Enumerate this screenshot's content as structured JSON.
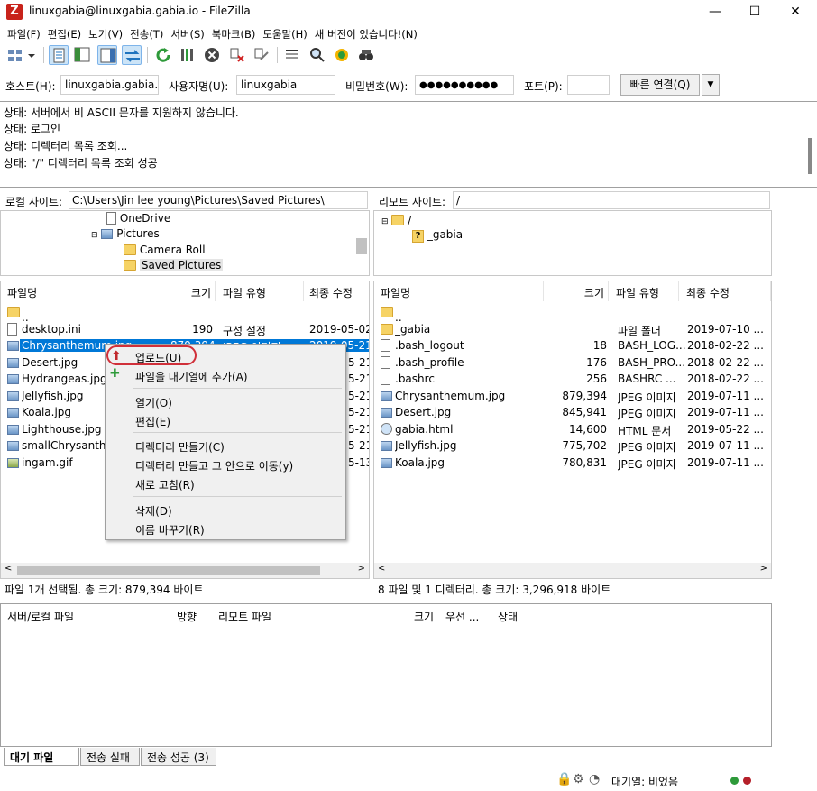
{
  "window": {
    "title": "linuxgabia@linuxgabia.gabia.io - FileZilla",
    "app_icon_letter": "Z",
    "minimize": "—",
    "maximize": "☐",
    "close": "✕"
  },
  "menu": [
    "파일(F)",
    "편집(E)",
    "보기(V)",
    "전송(T)",
    "서버(S)",
    "북마크(B)",
    "도움말(H)",
    "새 버전이 있습니다!(N)"
  ],
  "quickconnect": {
    "host_label": "호스트(H):",
    "host_value": "linuxgabia.gabia.io",
    "user_label": "사용자명(U):",
    "user_value": "linuxgabia",
    "pass_label": "비밀번호(W):",
    "pass_value": "●●●●●●●●●●",
    "port_label": "포트(P):",
    "port_value": "",
    "connect_label": "빠른 연결(Q)",
    "dropdown": "▼"
  },
  "log": [
    "상태:  서버에서 비 ASCII 문자를 지원하지 않습니다.",
    "상태:  로그인",
    "상태:  디렉터리 목록 조회...",
    "상태:  \"/\" 디렉터리 목록 조회 성공"
  ],
  "local": {
    "label": "로컬 사이트:",
    "path": "C:\\Users\\Jin lee young\\Pictures\\Saved Pictures\\",
    "tree": [
      "OneDrive",
      "Pictures",
      "Camera Roll",
      "Saved Pictures"
    ],
    "headers": [
      "파일명",
      "크기",
      "파일 유형",
      "최종 수정"
    ],
    "files": [
      {
        "name": "..",
        "size": "",
        "type": "",
        "date": ""
      },
      {
        "name": "desktop.ini",
        "size": "190",
        "type": "구성 설정",
        "date": "2019-05-02"
      },
      {
        "name": "Chrysanthemum.jpg",
        "size": "879,394",
        "type": "JPEG 이미지",
        "date": "2019-05-21"
      },
      {
        "name": "Desert.jpg",
        "size": "",
        "type": "",
        "date": "5-21"
      },
      {
        "name": "Hydrangeas.jpg",
        "size": "",
        "type": "",
        "date": "5-21"
      },
      {
        "name": "Jellyfish.jpg",
        "size": "",
        "type": "",
        "date": "5-21"
      },
      {
        "name": "Koala.jpg",
        "size": "",
        "type": "",
        "date": "5-21"
      },
      {
        "name": "Lighthouse.jpg",
        "size": "",
        "type": "",
        "date": "5-21"
      },
      {
        "name": "smallChrysanthem",
        "size": "",
        "type": "",
        "date": "5-21"
      },
      {
        "name": "ingam.gif",
        "size": "",
        "type": "",
        "date": "5-13"
      }
    ],
    "status": "파일 1개 선택됨. 총 크기: 879,394 바이트"
  },
  "remote": {
    "label": "리모트 사이트:",
    "path": "/",
    "tree": [
      "/",
      "_gabia"
    ],
    "headers": [
      "파일명",
      "크기",
      "파일 유형",
      "최종 수정"
    ],
    "files": [
      {
        "name": "..",
        "size": "",
        "type": "",
        "date": ""
      },
      {
        "name": "_gabia",
        "size": "",
        "type": "파일 폴더",
        "date": "2019-07-10 ..."
      },
      {
        "name": ".bash_logout",
        "size": "18",
        "type": "BASH_LOG...",
        "date": "2018-02-22 ..."
      },
      {
        "name": ".bash_profile",
        "size": "176",
        "type": "BASH_PRO...",
        "date": "2018-02-22 ..."
      },
      {
        "name": ".bashrc",
        "size": "256",
        "type": "BASHRC ...",
        "date": "2018-02-22 ..."
      },
      {
        "name": "Chrysanthemum.jpg",
        "size": "879,394",
        "type": "JPEG 이미지",
        "date": "2019-07-11 ..."
      },
      {
        "name": "Desert.jpg",
        "size": "845,941",
        "type": "JPEG 이미지",
        "date": "2019-07-11 ..."
      },
      {
        "name": "gabia.html",
        "size": "14,600",
        "type": "HTML 문서",
        "date": "2019-05-22 ..."
      },
      {
        "name": "Jellyfish.jpg",
        "size": "775,702",
        "type": "JPEG 이미지",
        "date": "2019-07-11 ..."
      },
      {
        "name": "Koala.jpg",
        "size": "780,831",
        "type": "JPEG 이미지",
        "date": "2019-07-11 ..."
      }
    ],
    "status": "8 파일 및 1 디렉터리. 총 크기: 3,296,918 바이트"
  },
  "context_menu": {
    "upload": "업로드(U)",
    "add_queue": "파일을 대기열에 추가(A)",
    "open": "열기(O)",
    "edit": "편집(E)",
    "mkdir": "디렉터리 만들기(C)",
    "mkdir_enter": "디렉터리 만들고 그 안으로 이동(y)",
    "refresh": "새로 고침(R)",
    "delete": "삭제(D)",
    "rename": "이름 바꾸기(R)"
  },
  "queue": {
    "headers": [
      "서버/로컬 파일",
      "방향",
      "리모트 파일",
      "크기",
      "우선 ...",
      "상태"
    ],
    "tabs": [
      "대기 파일",
      "전송 실패",
      "전송 성공 (3)"
    ]
  },
  "statusbar": {
    "queue_text": "대기열: 비었음"
  },
  "colors": {
    "selection": "#0078d7",
    "highlight_ring": "#d0303a",
    "folder": "#f6d365"
  }
}
